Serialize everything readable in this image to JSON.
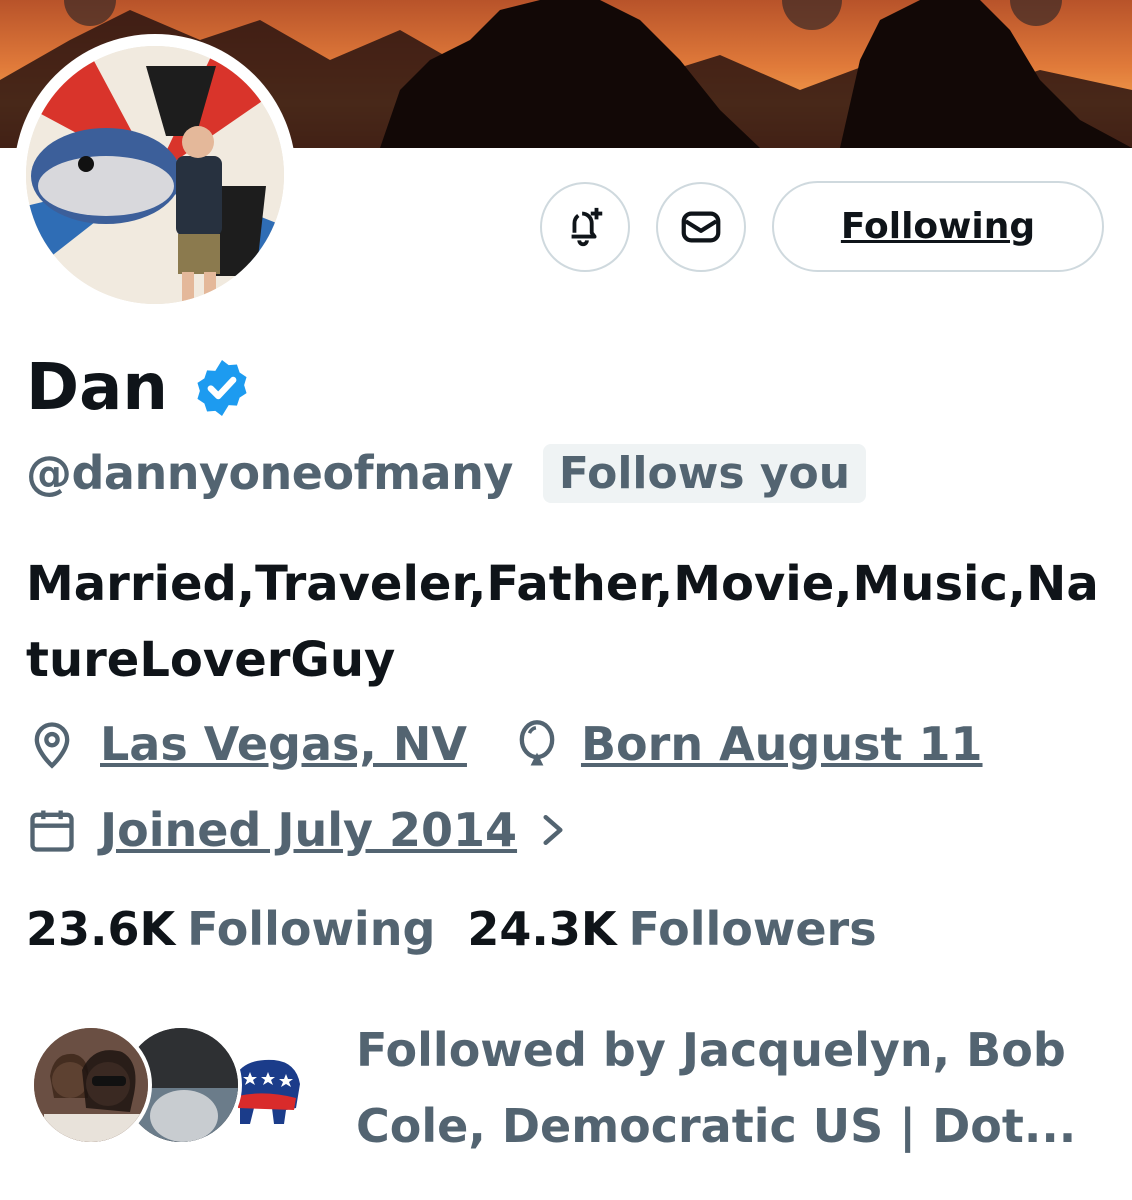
{
  "profile": {
    "name": "Dan",
    "handle": "@dannyoneofmany",
    "follows_you": "Follows you",
    "bio": "Married,Traveler,Father,Movie,Music,NatureLoverGuy",
    "location": "Las Vegas, NV",
    "birthday": "Born August 11",
    "joined": "Joined July 2014",
    "verified": true
  },
  "actions": {
    "notify_icon": "bell-plus-icon",
    "message_icon": "envelope-icon",
    "follow_label": "Following"
  },
  "stats": {
    "following_count": "23.6K",
    "following_label": "Following",
    "followers_count": "24.3K",
    "followers_label": "Followers"
  },
  "followed_by": {
    "text": "Followed by Jacquelyn, Bob Cole, Democratic US | Dot..."
  },
  "colors": {
    "verified_blue": "#1d9bf0",
    "secondary_text": "#536471",
    "primary_text": "#0f1419",
    "border": "#cfd9de"
  }
}
